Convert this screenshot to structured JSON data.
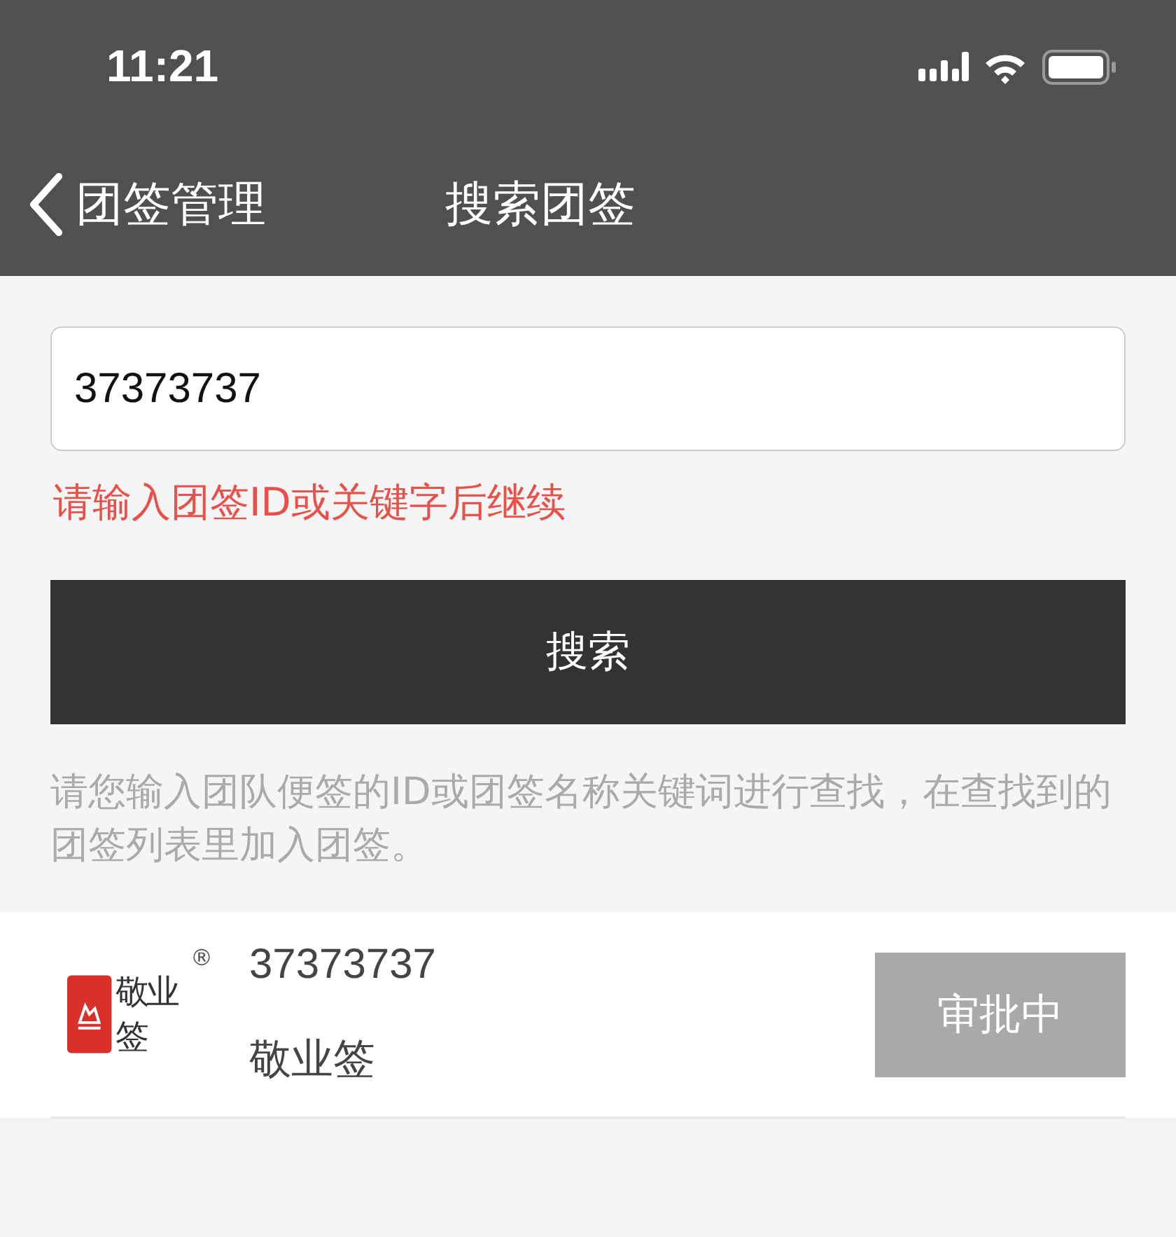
{
  "status_bar": {
    "time": "11:21"
  },
  "nav": {
    "back_label": "团签管理",
    "title": "搜索团签"
  },
  "search": {
    "value": "37373737",
    "error": "请输入团签ID或关键字后继续",
    "button": "搜索",
    "hint": "请您输入团队便签的ID或团签名称关键词进行查找，在查找到的团签列表里加入团签。"
  },
  "results": [
    {
      "logo_text": "敬业签",
      "logo_mark": "®",
      "id": "37373737",
      "name": "敬业签",
      "status": "审批中"
    }
  ]
}
